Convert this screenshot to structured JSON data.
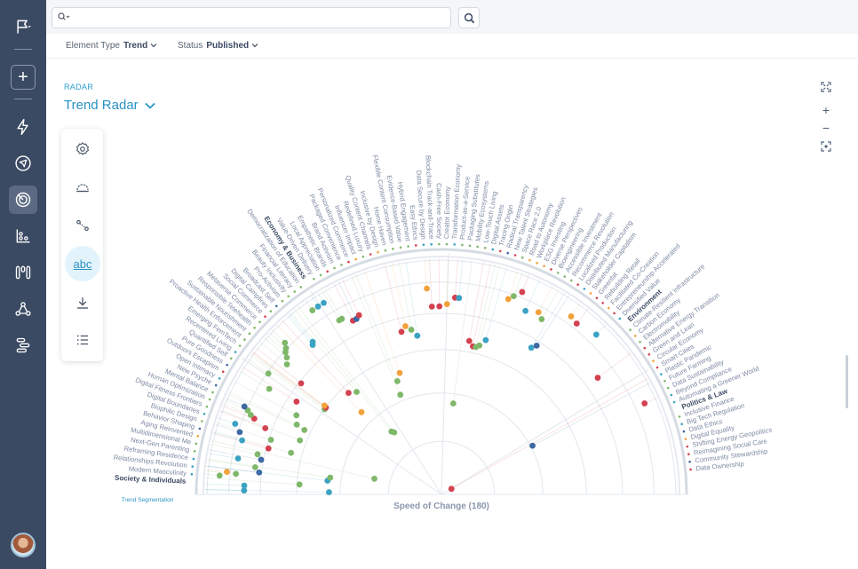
{
  "sidebar": {
    "icons": [
      "flag-icon",
      "add-icon",
      "bolt-icon",
      "navigation-icon",
      "radar-icon",
      "scatter-chart-icon",
      "columns-icon",
      "network-icon",
      "gantt-icon"
    ],
    "active": "radar-icon",
    "add_label": "+"
  },
  "search": {
    "placeholder": "",
    "value": ""
  },
  "filters": [
    {
      "label": "Element Type",
      "value": "Trend"
    },
    {
      "label": "Status",
      "value": "Published"
    }
  ],
  "header": {
    "kicker": "RADAR",
    "title": "Trend Radar"
  },
  "tools": [
    {
      "name": "settings-tool",
      "icon": "gear-icon"
    },
    {
      "name": "shape-tool",
      "icon": "half-circle-icon"
    },
    {
      "name": "connections-tool",
      "icon": "connection-icon"
    },
    {
      "name": "labels-tool",
      "icon": "abc-icon",
      "label": "abc",
      "active": true
    },
    {
      "name": "download-tool",
      "icon": "download-icon"
    },
    {
      "name": "legend-tool",
      "icon": "list-icon"
    }
  ],
  "controls": {
    "fullscreen": "fullscreen-icon",
    "zoom_in": "+",
    "zoom_out": "−",
    "center": "center-icon"
  },
  "radar": {
    "axis_label": "Speed of Change (180)",
    "segmentation_label": "Trend Segmentation",
    "colors": {
      "green": "#7fb86a",
      "red": "#d44150",
      "blue": "#3e68a3",
      "teal": "#3aa3c4",
      "orange": "#f2a23a"
    },
    "segments": [
      {
        "name": "Society & Individuals",
        "trends": [
          {
            "t": "Modern Masculinity",
            "c": "teal"
          },
          {
            "t": "Relationships Revolution",
            "c": "teal"
          },
          {
            "t": "Reframing Residence",
            "c": "teal"
          },
          {
            "t": "Next-Gen Parenting",
            "c": "green"
          },
          {
            "t": "Multidimensional Me",
            "c": "green"
          },
          {
            "t": "Aging Reinvented",
            "c": "orange"
          },
          {
            "t": "Behavior Shaping",
            "c": "blue"
          },
          {
            "t": "Biophilic Design",
            "c": "green"
          },
          {
            "t": "Digital Boundaries",
            "c": "teal"
          },
          {
            "t": "Digital Fitness Frontiers",
            "c": "green"
          },
          {
            "t": "Human Optimization",
            "c": "green"
          },
          {
            "t": "Mental Balance",
            "c": "green"
          },
          {
            "t": "New Psyche",
            "c": "blue"
          },
          {
            "t": "Open Intimacy",
            "c": "teal"
          },
          {
            "t": "Outdoors Escapism",
            "c": "red"
          },
          {
            "t": "Pure Goodness",
            "c": "blue"
          },
          {
            "t": "Quantified Self",
            "c": "green"
          },
          {
            "t": "Recentered Living",
            "c": "teal"
          },
          {
            "t": "Emerging FemTech",
            "c": "green"
          },
          {
            "t": "Proactive Health Enforcement",
            "c": "green"
          },
          {
            "t": "Sustainable Nourishment",
            "c": "green"
          },
          {
            "t": "Responsible Telehealth",
            "c": "green"
          },
          {
            "t": "Metaverse Commerce",
            "c": "green"
          },
          {
            "t": "Social Commerce",
            "c": "red"
          },
          {
            "t": "Digital Campfires",
            "c": "green"
          },
          {
            "t": "Broadcast Self",
            "c": "blue"
          },
          {
            "t": "Pro-Activism",
            "c": "green"
          },
          {
            "t": "Beauty Inclusivity",
            "c": "green"
          },
          {
            "t": "Financial Literacy",
            "c": "green"
          },
          {
            "t": "Democratization of Education",
            "c": "green"
          }
        ]
      },
      {
        "name": "Economy & Business",
        "trends": [
          {
            "t": "Value-Driven Delivery",
            "c": "green"
          },
          {
            "t": "Local Appreciation",
            "c": "green"
          },
          {
            "t": "Empathetic Brands",
            "c": "red"
          },
          {
            "t": "Brand Activism",
            "c": "green"
          },
          {
            "t": "Packaged Convenience",
            "c": "green"
          },
          {
            "t": "Personalized Commerce",
            "c": "red"
          },
          {
            "t": "Influencer Impact",
            "c": "orange"
          },
          {
            "t": "Redefined Luxury",
            "c": "green"
          },
          {
            "t": "Quality Content Channels",
            "c": "red"
          },
          {
            "t": "Inclusive by Design",
            "c": "orange"
          },
          {
            "t": "Home Haven",
            "c": "green"
          },
          {
            "t": "Flexible Content Consumption",
            "c": "green"
          },
          {
            "t": "Evidence-Based Value",
            "c": "green"
          },
          {
            "t": "Hybrid Engagement",
            "c": "green"
          },
          {
            "t": "Easy Ethics",
            "c": "red"
          },
          {
            "t": "Data Secure by Design",
            "c": "teal"
          },
          {
            "t": "Blockchain Track-and-Trace",
            "c": "teal"
          },
          {
            "t": "Cash-Free Society",
            "c": "green"
          },
          {
            "t": "Creator Economy",
            "c": "green"
          },
          {
            "t": "Transformation Economy",
            "c": "teal"
          },
          {
            "t": "Product-as-a-Service",
            "c": "green"
          },
          {
            "t": "Packaging Substitutes",
            "c": "green"
          },
          {
            "t": "Mobility Ecosystems",
            "c": "green"
          },
          {
            "t": "Low-Touch Living",
            "c": "green"
          },
          {
            "t": "Digital Assets",
            "c": "teal"
          },
          {
            "t": "Tracing Origin",
            "c": "red"
          },
          {
            "t": "Radical Transparency",
            "c": "blue"
          },
          {
            "t": "New Talent Strategies",
            "c": "red"
          },
          {
            "t": "Space Race 2.0",
            "c": "green"
          },
          {
            "t": "Road to Autonomy",
            "c": "orange"
          },
          {
            "t": "Workplace Revolution",
            "c": "orange"
          },
          {
            "t": "ESG Investing",
            "c": "orange"
          },
          {
            "t": "Diverse Perspectives",
            "c": "red"
          },
          {
            "t": "Bioengineering",
            "c": "green"
          },
          {
            "t": "Accessible Investment",
            "c": "green"
          },
          {
            "t": "Recommerce Revolution",
            "c": "green"
          },
          {
            "t": "Localized Production",
            "c": "red"
          },
          {
            "t": "Distributed Manufacturing",
            "c": "teal"
          },
          {
            "t": "Stakeholder Capitalism",
            "c": "orange"
          },
          {
            "t": "Greenfat",
            "c": "red"
          },
          {
            "t": "Rebuilding Retail",
            "c": "red"
          },
          {
            "t": "Facilitated Co-Creation",
            "c": "orange"
          },
          {
            "t": "Entrepreneurship Accelerated",
            "c": "red"
          },
          {
            "t": "Diversified Value",
            "c": "teal"
          }
        ]
      },
      {
        "name": "Environment",
        "trends": [
          {
            "t": "Climate-Resilient Infrastructure",
            "c": "green"
          },
          {
            "t": "Carbon Economy",
            "c": "orange"
          },
          {
            "t": "Electromobility",
            "c": "green"
          },
          {
            "t": "Alternative Energy Transition",
            "c": "red"
          },
          {
            "t": "Green and Lean",
            "c": "red"
          },
          {
            "t": "Circular Economy",
            "c": "orange"
          },
          {
            "t": "Smart Cities",
            "c": "red"
          },
          {
            "t": "Plastic Pandemic",
            "c": "teal"
          },
          {
            "t": "Future Farming",
            "c": "green"
          },
          {
            "t": "Data Sustainability",
            "c": "green"
          },
          {
            "t": "Beyond Compliance",
            "c": "teal"
          },
          {
            "t": "Automating a Greener World",
            "c": "teal"
          }
        ]
      },
      {
        "name": "Politics & Law",
        "trends": [
          {
            "t": "Inclusive Finance",
            "c": "green"
          },
          {
            "t": "Big Tech Regulation",
            "c": "teal"
          },
          {
            "t": "Data Ethics",
            "c": "blue"
          },
          {
            "t": "Digital Equality",
            "c": "orange"
          },
          {
            "t": "Shifting Energy Geopolitics",
            "c": "red"
          },
          {
            "t": "Reimagining Social Care",
            "c": "red"
          },
          {
            "t": "Community Stewardship",
            "c": "blue"
          },
          {
            "t": "Data Ownership",
            "c": "red"
          }
        ]
      }
    ],
    "points": [
      {
        "a": 0.02,
        "r": 0.86,
        "c": "teal"
      },
      {
        "a": 0.02,
        "r": 0.49,
        "c": "teal"
      },
      {
        "a": 0.045,
        "r": 0.86,
        "c": "teal"
      },
      {
        "a": 0.07,
        "r": 0.62,
        "c": "green"
      },
      {
        "a": 0.085,
        "r": 0.97,
        "c": "green"
      },
      {
        "a": 0.1,
        "r": 0.9,
        "c": "green"
      },
      {
        "a": 0.105,
        "r": 0.94,
        "c": "orange"
      },
      {
        "a": 0.12,
        "r": 0.8,
        "c": "blue"
      },
      {
        "a": 0.12,
        "r": 0.5,
        "c": "teal"
      },
      {
        "a": 0.145,
        "r": 0.82,
        "c": "green"
      },
      {
        "a": 0.15,
        "r": 0.49,
        "c": "green"
      },
      {
        "a": 0.175,
        "r": 0.9,
        "c": "teal"
      },
      {
        "a": 0.19,
        "r": 0.8,
        "c": "blue"
      },
      {
        "a": 0.215,
        "r": 0.82,
        "c": "green"
      },
      {
        "a": 0.23,
        "r": 0.3,
        "c": "green"
      },
      {
        "a": 0.26,
        "r": 0.78,
        "c": "red"
      },
      {
        "a": 0.265,
        "r": 0.9,
        "c": "teal"
      },
      {
        "a": 0.27,
        "r": 0.68,
        "c": "green"
      },
      {
        "a": 0.3,
        "r": 0.92,
        "c": "blue"
      },
      {
        "a": 0.31,
        "r": 0.78,
        "c": "green"
      },
      {
        "a": 0.33,
        "r": 0.95,
        "c": "teal"
      },
      {
        "a": 0.36,
        "r": 0.82,
        "c": "red"
      },
      {
        "a": 0.365,
        "r": 0.66,
        "c": "green"
      },
      {
        "a": 0.385,
        "r": 0.88,
        "c": "red"
      },
      {
        "a": 0.395,
        "r": 0.9,
        "c": "green"
      },
      {
        "a": 0.41,
        "r": 0.92,
        "c": "green"
      },
      {
        "a": 0.42,
        "r": 0.94,
        "c": "blue"
      },
      {
        "a": 0.44,
        "r": 0.66,
        "c": "green"
      },
      {
        "a": 0.45,
        "r": 0.7,
        "c": "green"
      },
      {
        "a": 0.5,
        "r": 0.72,
        "c": "green"
      },
      {
        "a": 0.55,
        "r": 0.88,
        "c": "green"
      },
      {
        "a": 0.57,
        "r": 0.75,
        "c": "red"
      },
      {
        "a": 0.61,
        "r": 0.92,
        "c": "green"
      },
      {
        "a": 0.63,
        "r": 0.63,
        "c": "green"
      },
      {
        "a": 0.64,
        "r": 0.63,
        "c": "green"
      },
      {
        "a": 0.645,
        "r": 0.63,
        "c": "red"
      },
      {
        "a": 0.65,
        "r": 0.64,
        "c": "orange"
      },
      {
        "a": 0.67,
        "r": 0.78,
        "c": "red"
      },
      {
        "a": 0.7,
        "r": 0.88,
        "c": "green"
      },
      {
        "a": 0.725,
        "r": 0.9,
        "c": "green"
      },
      {
        "a": 0.74,
        "r": 0.92,
        "c": "green"
      },
      {
        "a": 0.755,
        "r": 0.93,
        "c": "green"
      },
      {
        "a": 0.77,
        "r": 0.95,
        "c": "green"
      },
      {
        "a": 0.8,
        "r": 0.5,
        "c": "orange"
      },
      {
        "a": 0.83,
        "r": 0.6,
        "c": "red"
      },
      {
        "a": 0.86,
        "r": 0.86,
        "c": "teal"
      },
      {
        "a": 0.87,
        "r": 0.87,
        "c": "teal"
      },
      {
        "a": 0.88,
        "r": 0.58,
        "c": "green"
      },
      {
        "a": 0.9,
        "r": 0.35,
        "c": "green"
      },
      {
        "a": 0.92,
        "r": 0.34,
        "c": "green"
      },
      {
        "a": 0.96,
        "r": 0.98,
        "c": "green"
      },
      {
        "a": 0.99,
        "r": 0.98,
        "c": "teal"
      },
      {
        "a": 1.02,
        "r": 0.98,
        "c": "teal"
      },
      {
        "a": 1.04,
        "r": 0.88,
        "c": "green"
      },
      {
        "a": 1.055,
        "r": 0.88,
        "c": "green"
      },
      {
        "a": 1.1,
        "r": 0.85,
        "c": "red"
      },
      {
        "a": 1.12,
        "r": 0.85,
        "c": "blue"
      },
      {
        "a": 1.14,
        "r": 0.86,
        "c": "red"
      },
      {
        "a": 1.18,
        "r": 0.47,
        "c": "green"
      },
      {
        "a": 1.2,
        "r": 0.53,
        "c": "green"
      },
      {
        "a": 1.24,
        "r": 0.56,
        "c": "orange"
      },
      {
        "a": 1.33,
        "r": 0.73,
        "c": "red"
      },
      {
        "a": 1.36,
        "r": 0.75,
        "c": "orange"
      },
      {
        "a": 1.39,
        "r": 0.73,
        "c": "green"
      },
      {
        "a": 1.42,
        "r": 0.7,
        "c": "teal"
      },
      {
        "a": 1.5,
        "r": 0.9,
        "c": "orange"
      },
      {
        "a": 1.52,
        "r": 0.82,
        "c": "red"
      },
      {
        "a": 1.56,
        "r": 0.82,
        "c": "red"
      },
      {
        "a": 1.6,
        "r": 0.83,
        "c": "orange"
      },
      {
        "a": 1.64,
        "r": 0.86,
        "c": "red"
      },
      {
        "a": 1.66,
        "r": 0.86,
        "c": "teal"
      },
      {
        "a": 1.7,
        "r": 0.4,
        "c": "green"
      },
      {
        "a": 1.75,
        "r": 0.68,
        "c": "red"
      },
      {
        "a": 1.78,
        "r": 0.66,
        "c": "red"
      },
      {
        "a": 1.8,
        "r": 0.66,
        "c": "green"
      },
      {
        "a": 1.82,
        "r": 0.67,
        "c": "green"
      },
      {
        "a": 1.85,
        "r": 0.7,
        "c": "teal"
      },
      {
        "a": 1.9,
        "r": 0.9,
        "c": "orange"
      },
      {
        "a": 1.92,
        "r": 0.92,
        "c": "green"
      },
      {
        "a": 1.95,
        "r": 0.95,
        "c": "red"
      },
      {
        "a": 2.0,
        "r": 0.88,
        "c": "teal"
      },
      {
        "a": 2.06,
        "r": 0.9,
        "c": "orange"
      },
      {
        "a": 2.09,
        "r": 0.88,
        "c": "green"
      },
      {
        "a": 2.12,
        "r": 0.75,
        "c": "teal"
      },
      {
        "a": 2.14,
        "r": 0.77,
        "c": "blue"
      },
      {
        "a": 2.2,
        "r": 0.96,
        "c": "orange"
      },
      {
        "a": 2.24,
        "r": 0.95,
        "c": "red"
      },
      {
        "a": 2.34,
        "r": 0.97,
        "c": "teal"
      },
      {
        "a": 2.5,
        "r": 0.85,
        "c": "red"
      },
      {
        "a": 2.63,
        "r": 0.05,
        "c": "red"
      },
      {
        "a": 2.65,
        "r": 0.45,
        "c": "blue"
      },
      {
        "a": 2.72,
        "r": 0.97,
        "c": "red"
      }
    ]
  }
}
